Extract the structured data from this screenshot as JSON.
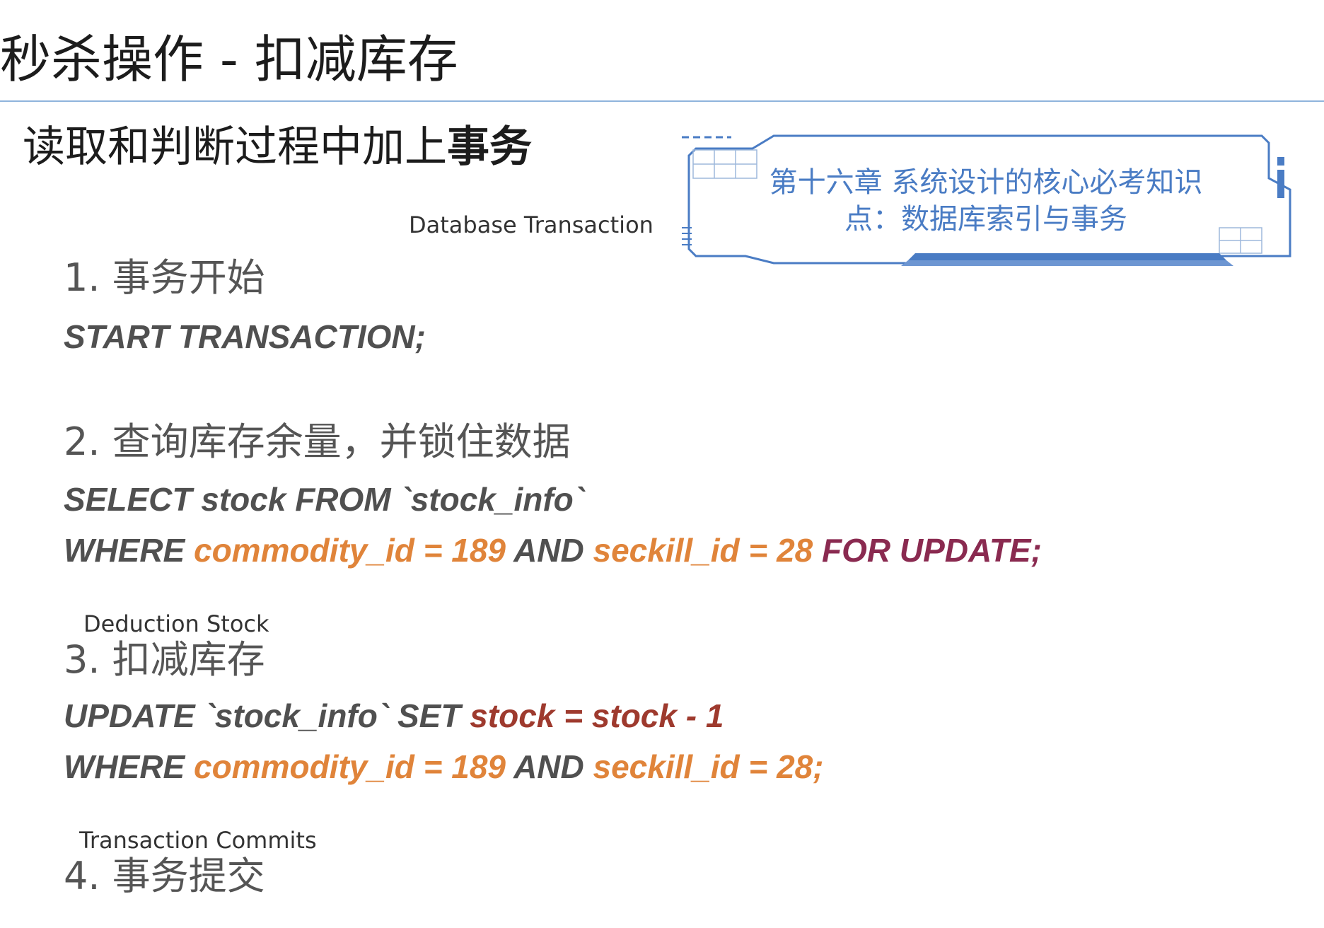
{
  "slide": {
    "title": "秒杀操作 - 扣减库存",
    "subtitle_normal": "读取和判断过程中加上",
    "subtitle_bold": "事务"
  },
  "annotations": {
    "database_transaction": "Database Transaction",
    "deduction_stock": "Deduction Stock",
    "transaction_commits": "Transaction Commits"
  },
  "card": {
    "text": "第十六章 系统设计的核心必考知识点：数据库索引与事务",
    "accent_color": "#4a7cc4"
  },
  "steps": [
    {
      "label": "1. 事务开始"
    },
    {
      "label": "2. 查询库存余量，并锁住数据"
    },
    {
      "label": "3. 扣减库存"
    },
    {
      "label": "4. 事务提交"
    }
  ],
  "code": {
    "start": "START TRANSACTION;",
    "select_line1": "SELECT stock FROM `stock_info`",
    "select_where": "WHERE ",
    "select_cond1": "commodity_id = 189",
    "select_and": " AND ",
    "select_cond2": "seckill_id = 28",
    "select_lock": " FOR UPDATE;",
    "update_prefix": "UPDATE `stock_info` SET ",
    "update_set": "stock = stock - 1",
    "update_where": "WHERE ",
    "update_cond1": "commodity_id = 189",
    "update_and": " AND ",
    "update_cond2": "seckill_id = 28;"
  },
  "colors": {
    "keyword": "#505050",
    "highlight": "#e0843a",
    "lock": "#8a2a50",
    "set": "#9e3a2e",
    "rule": "#8fb4dc"
  }
}
